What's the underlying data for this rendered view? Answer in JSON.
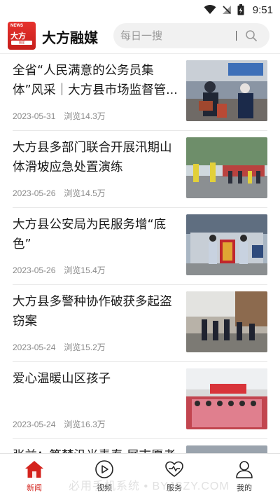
{
  "status_bar": {
    "time": "9:51"
  },
  "header": {
    "logo": {
      "top_text": "NEWS",
      "main_text": "大方",
      "strip_text": "融媒"
    },
    "app_title": "大方融媒",
    "search_placeholder": "每日一搜"
  },
  "news": [
    {
      "title": "全省“人民满意的公务员集体”风采｜大方县市场监督管...",
      "date": "2023-05-31",
      "views": "浏览14.3万"
    },
    {
      "title": "大方县多部门联合开展汛期山体滑坡应急处置演练",
      "date": "2023-05-26",
      "views": "浏览14.5万"
    },
    {
      "title": "大方县公安局为民服务增“底色”",
      "date": "2023-05-26",
      "views": "浏览15.4万"
    },
    {
      "title": "大方县多警种协作破获多起盗窃案",
      "date": "2023-05-24",
      "views": "浏览15.2万"
    },
    {
      "title": "爱心温暖山区孩子",
      "date": "2023-05-24",
      "views": "浏览16.3万"
    },
    {
      "title": "张益：笃梦汎光青春 展志愿者",
      "date": "",
      "views": ""
    }
  ],
  "bottom_nav": [
    {
      "label": "新闻",
      "icon": "home-icon",
      "active": true
    },
    {
      "label": "视频",
      "icon": "play-icon",
      "active": false
    },
    {
      "label": "服务",
      "icon": "heart-icon",
      "active": false
    },
    {
      "label": "我的",
      "icon": "user-icon",
      "active": false
    }
  ],
  "watermark": "必用手机系统 • BYJSZY.COM",
  "colors": {
    "accent": "#d4231d",
    "logo_red": "#e6322d"
  }
}
